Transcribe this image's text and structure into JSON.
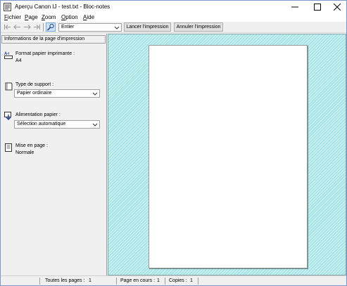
{
  "window": {
    "title": "Aperçu Canon IJ - test.txt - Bloc-notes",
    "min_glyph": "—",
    "max_glyph": "☐",
    "close_glyph": "✕"
  },
  "menu": [
    "Fichier",
    "Page",
    "Zoom",
    "Option",
    "Aide"
  ],
  "toolbar": {
    "zoom_value": "Entier",
    "start_print_label": "Lancer l'impression",
    "cancel_print_label": "Annuler l'impression"
  },
  "panel": {
    "header": "Informations de la page d'impression",
    "paper_size_label": "Format papier imprimante :",
    "paper_size_value": "A4",
    "media_type_label": "Type de support :",
    "media_type_value": "Papier ordinaire",
    "paper_source_label": "Alimentation papier :",
    "paper_source_value": "Sélection automatique",
    "layout_label": "Mise en page :",
    "layout_value": "Normale"
  },
  "status": {
    "total_pages_label": "Toutes les pages :",
    "total_pages_value": "1",
    "current_page_label": "Page en cours :",
    "current_page_value": "1",
    "copies_label": "Copies :",
    "copies_value": "1"
  },
  "colors": {
    "preview_background": "#a6e4e6",
    "title_accent": "#7a98c8"
  }
}
